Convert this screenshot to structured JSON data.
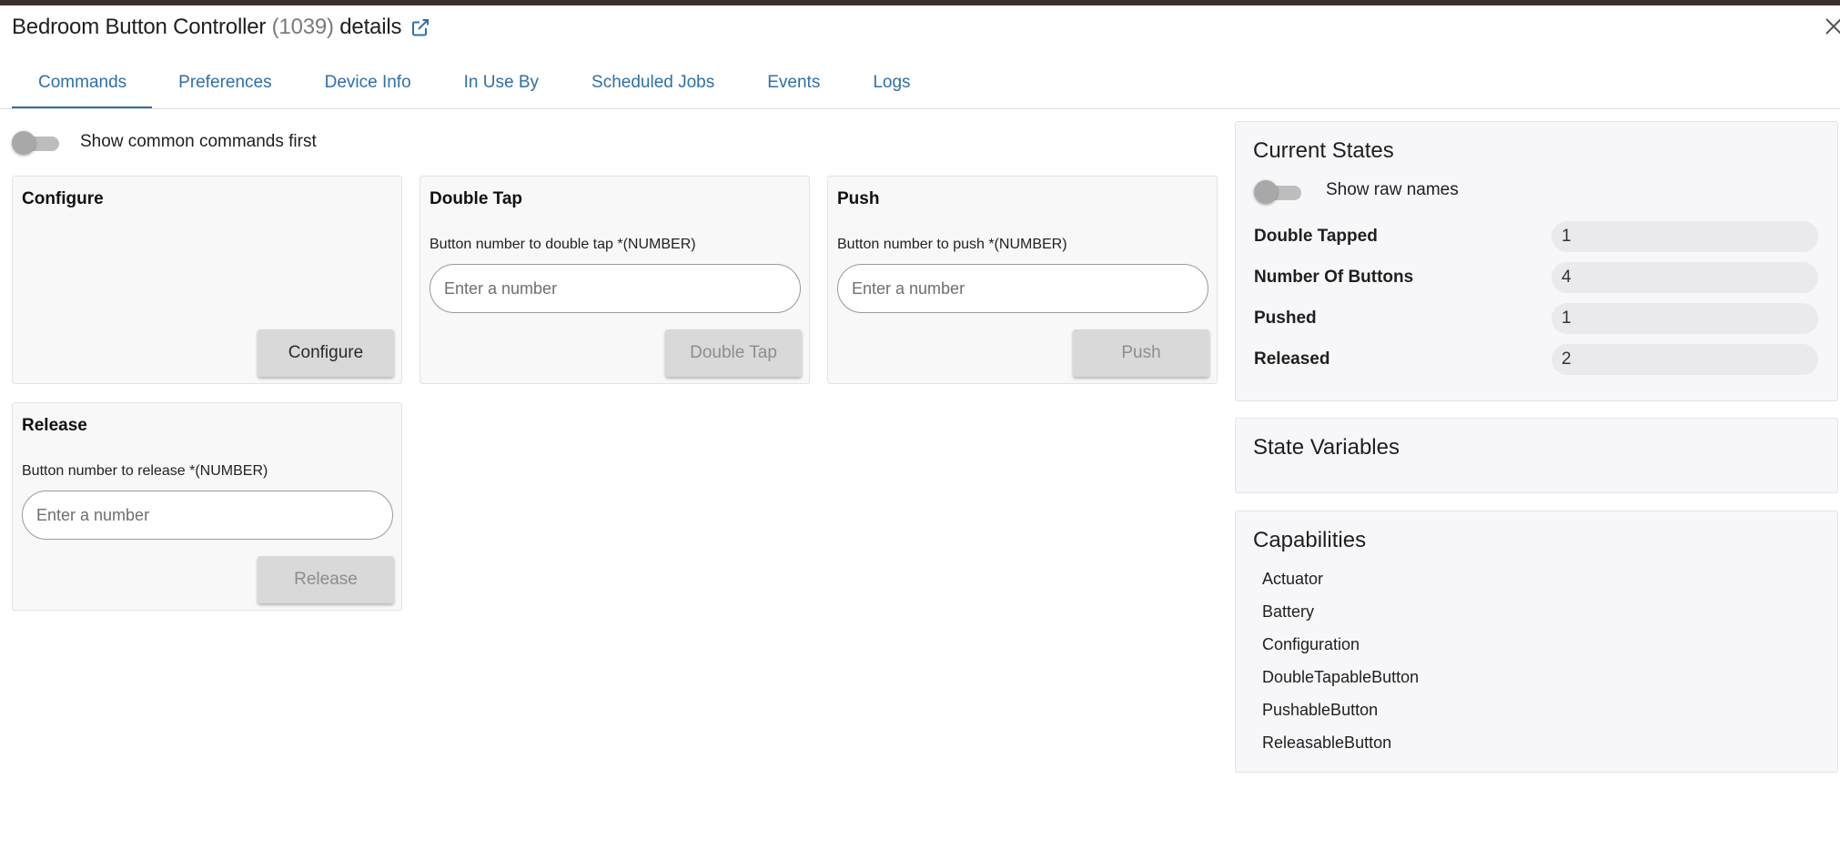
{
  "header": {
    "device_name": "Bedroom Button Controller",
    "device_id": "(1039)",
    "suffix": "details",
    "open_link_icon": "external-link-icon",
    "close_icon": "close-icon"
  },
  "tabs": [
    {
      "label": "Commands",
      "active": true
    },
    {
      "label": "Preferences",
      "active": false
    },
    {
      "label": "Device Info",
      "active": false
    },
    {
      "label": "In Use By",
      "active": false
    },
    {
      "label": "Scheduled Jobs",
      "active": false
    },
    {
      "label": "Events",
      "active": false
    },
    {
      "label": "Logs",
      "active": false
    }
  ],
  "commands": {
    "common_toggle_label": "Show common commands first",
    "common_toggle_on": false,
    "cards": [
      {
        "title": "Configure",
        "param_label": "",
        "placeholder": "",
        "button": "Configure",
        "enabled": true
      },
      {
        "title": "Double Tap",
        "param_label": "Button number to double tap *(NUMBER)",
        "placeholder": "Enter a number",
        "button": "Double Tap",
        "enabled": false
      },
      {
        "title": "Push",
        "param_label": "Button number to push *(NUMBER)",
        "placeholder": "Enter a number",
        "button": "Push",
        "enabled": false
      },
      {
        "title": "Release",
        "param_label": "Button number to release *(NUMBER)",
        "placeholder": "Enter a number",
        "button": "Release",
        "enabled": false
      }
    ]
  },
  "current_states": {
    "title": "Current States",
    "raw_names_label": "Show raw names",
    "raw_names_on": false,
    "rows": [
      {
        "name": "Double Tapped",
        "value": "1"
      },
      {
        "name": "Number Of Buttons",
        "value": "4"
      },
      {
        "name": "Pushed",
        "value": "1"
      },
      {
        "name": "Released",
        "value": "2"
      }
    ]
  },
  "state_variables": {
    "title": "State Variables"
  },
  "capabilities": {
    "title": "Capabilities",
    "items": [
      "Actuator",
      "Battery",
      "Configuration",
      "DoubleTapableButton",
      "PushableButton",
      "ReleasableButton"
    ]
  },
  "colors": {
    "accent": "#2f6fa8",
    "topbar": "#3b2f2a"
  }
}
